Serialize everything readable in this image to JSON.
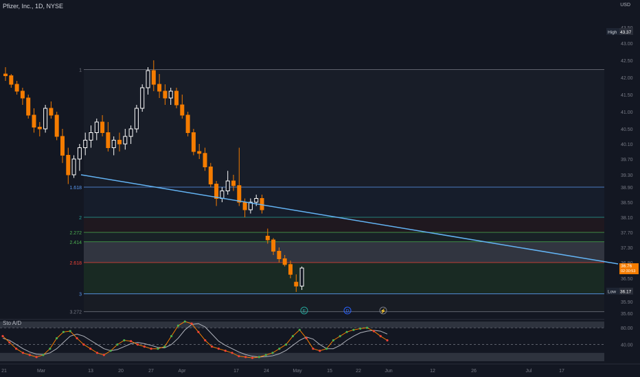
{
  "header": {
    "title": "Pfizer, Inc., 1D, NYSE",
    "currency": "USD"
  },
  "indicator_label": "Sto A/D",
  "colors": {
    "bg": "#131722",
    "up": "#ffffff",
    "down": "#f57c00",
    "trend": "#64b5f6"
  },
  "chart_data": {
    "type": "candlestick",
    "title": "Pfizer, Inc., 1D, NYSE",
    "y_ticks": [
      "43.50",
      "43.00",
      "42.50",
      "42.00",
      "41.50",
      "41.00",
      "40.50",
      "40.10",
      "39.70",
      "39.30",
      "38.90",
      "38.50",
      "38.10",
      "37.70",
      "37.30",
      "36.90",
      "36.50",
      "35.90",
      "35.60"
    ],
    "x_ticks": [
      "21",
      "Mar",
      "13",
      "20",
      "27",
      "Apr",
      "17",
      "24",
      "May",
      "15",
      "22",
      "Jun",
      "12",
      "26",
      "Jul",
      "17"
    ],
    "price_badges": [
      {
        "label": "High",
        "value": "43.37",
        "kind": "high"
      },
      {
        "label": "Low",
        "value": "36.17",
        "kind": "low"
      },
      {
        "label": "",
        "value": "36.76",
        "sub": "02:30:53",
        "kind": "last"
      }
    ],
    "fib_levels": [
      {
        "label": "1",
        "price": 42.23,
        "color": "#787b86"
      },
      {
        "label": "1.618",
        "price": 38.9,
        "color": "#5b9cf6"
      },
      {
        "label": "2",
        "price": 38.1,
        "color": "#26a69a"
      },
      {
        "label": "2.272",
        "price": 37.7,
        "color": "#4caf50"
      },
      {
        "label": "2.414",
        "price": 37.45,
        "color": "#4caf50"
      },
      {
        "label": "2.618",
        "price": 36.9,
        "color": "#f44336"
      },
      {
        "label": "3",
        "price": 36.1,
        "color": "#5b9cf6"
      },
      {
        "label": "3.272",
        "price": 35.64,
        "color": "#787b86"
      }
    ],
    "events": [
      "E",
      "D",
      "⚡"
    ],
    "candles": [
      [
        42.1,
        42.3,
        41.9,
        42.05
      ],
      [
        42.05,
        42.1,
        41.7,
        41.8
      ],
      [
        41.8,
        41.9,
        41.5,
        41.6
      ],
      [
        41.6,
        41.7,
        41.2,
        41.4
      ],
      [
        41.4,
        41.5,
        40.8,
        40.9
      ],
      [
        40.9,
        41.1,
        40.4,
        40.55
      ],
      [
        40.55,
        40.7,
        40.3,
        40.5
      ],
      [
        40.5,
        41.2,
        40.4,
        41.1
      ],
      [
        41.1,
        41.3,
        40.8,
        40.9
      ],
      [
        40.9,
        41.0,
        40.2,
        40.3
      ],
      [
        40.3,
        40.5,
        39.6,
        39.8
      ],
      [
        39.8,
        40.0,
        39.0,
        39.3
      ],
      [
        39.3,
        39.8,
        39.2,
        39.7
      ],
      [
        39.7,
        40.1,
        39.4,
        40.0
      ],
      [
        40.0,
        40.4,
        39.8,
        40.2
      ],
      [
        40.2,
        40.6,
        40.0,
        40.4
      ],
      [
        40.4,
        40.8,
        40.2,
        40.7
      ],
      [
        40.7,
        40.9,
        40.3,
        40.4
      ],
      [
        40.4,
        40.7,
        39.9,
        40.0
      ],
      [
        40.0,
        40.3,
        39.8,
        40.2
      ],
      [
        40.2,
        40.4,
        39.9,
        40.1
      ],
      [
        40.1,
        40.5,
        39.95,
        40.3
      ],
      [
        40.3,
        40.6,
        40.1,
        40.5
      ],
      [
        40.5,
        41.2,
        40.4,
        41.1
      ],
      [
        41.1,
        41.8,
        41.0,
        41.7
      ],
      [
        41.7,
        42.3,
        41.5,
        42.2
      ],
      [
        42.2,
        42.5,
        41.6,
        41.8
      ],
      [
        41.8,
        42.1,
        41.4,
        41.6
      ],
      [
        41.6,
        41.8,
        41.2,
        41.4
      ],
      [
        41.4,
        41.7,
        41.2,
        41.6
      ],
      [
        41.6,
        41.7,
        41.1,
        41.2
      ],
      [
        41.2,
        41.5,
        40.8,
        40.9
      ],
      [
        40.9,
        41.0,
        40.3,
        40.4
      ],
      [
        40.4,
        40.5,
        39.8,
        39.9
      ],
      [
        39.9,
        40.1,
        39.7,
        39.85
      ],
      [
        39.85,
        40.0,
        39.4,
        39.5
      ],
      [
        39.5,
        39.6,
        38.9,
        39.0
      ],
      [
        39.0,
        39.1,
        38.4,
        38.6
      ],
      [
        38.6,
        38.9,
        38.5,
        38.8
      ],
      [
        38.8,
        39.4,
        38.7,
        39.1
      ],
      [
        39.1,
        39.3,
        38.8,
        38.95
      ],
      [
        38.95,
        40.0,
        38.4,
        38.5
      ],
      [
        38.5,
        38.6,
        38.1,
        38.3
      ],
      [
        38.3,
        38.6,
        38.2,
        38.5
      ],
      [
        38.5,
        38.7,
        38.4,
        38.6
      ],
      [
        38.6,
        38.7,
        38.2,
        38.3
      ],
      [
        37.6,
        37.8,
        37.4,
        37.5
      ],
      [
        37.5,
        37.55,
        37.1,
        37.2
      ],
      [
        37.2,
        37.3,
        36.9,
        37.0
      ],
      [
        37.0,
        37.1,
        36.8,
        36.85
      ],
      [
        36.85,
        36.95,
        36.5,
        36.6
      ],
      [
        36.4,
        36.6,
        36.15,
        36.3
      ],
      [
        36.3,
        36.8,
        36.2,
        36.76
      ]
    ],
    "stoch_levels": [
      {
        "label": "80.00",
        "value": 80
      },
      {
        "label": "40.00",
        "value": 40
      }
    ],
    "stoch_k": [
      60,
      45,
      30,
      20,
      15,
      10,
      15,
      30,
      55,
      70,
      72,
      55,
      40,
      30,
      20,
      15,
      25,
      40,
      50,
      48,
      40,
      35,
      30,
      30,
      35,
      60,
      85,
      95,
      90,
      70,
      50,
      35,
      30,
      25,
      20,
      12,
      10,
      8,
      10,
      15,
      20,
      30,
      40,
      60,
      75,
      55,
      30,
      25,
      30,
      50,
      60,
      70,
      75,
      78,
      80,
      72,
      60,
      50
    ],
    "stoch_d": [
      55,
      50,
      40,
      30,
      22,
      17,
      16,
      20,
      30,
      45,
      60,
      65,
      60,
      50,
      40,
      30,
      25,
      28,
      35,
      42,
      45,
      42,
      38,
      33,
      32,
      40,
      55,
      75,
      88,
      90,
      82,
      65,
      48,
      38,
      30,
      22,
      16,
      12,
      10,
      11,
      13,
      18,
      26,
      38,
      50,
      58,
      53,
      40,
      30,
      30,
      38,
      50,
      60,
      68,
      72,
      74,
      72,
      65
    ]
  }
}
